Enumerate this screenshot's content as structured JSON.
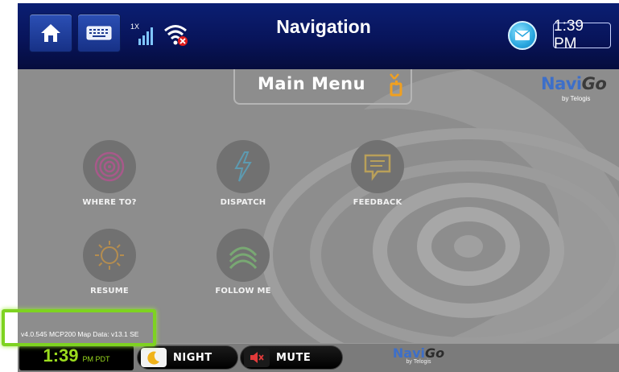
{
  "topbar": {
    "title": "Navigation",
    "time": "1:39 PM",
    "signal_label": "1X",
    "icons": [
      "home-icon",
      "keyboard-icon",
      "signal-icon",
      "wifi-off-icon",
      "mail-icon"
    ]
  },
  "main": {
    "title": "Main Menu",
    "brand": {
      "navi": "Navi",
      "go": "Go",
      "sub": "by Telogis"
    },
    "tiles": [
      {
        "label": "WHERE TO?",
        "icon": "target-icon"
      },
      {
        "label": "DISPATCH",
        "icon": "lightning-icon"
      },
      {
        "label": "FEEDBACK",
        "icon": "chat-icon"
      },
      {
        "label": "RESUME",
        "icon": "sun-icon"
      },
      {
        "label": "FOLLOW ME",
        "icon": "signal-waves-icon"
      }
    ],
    "version": "v4.0.545 MCP200   Map Data: v13.1 SE"
  },
  "bottombar": {
    "time": "1:39",
    "zone": "PM PDT",
    "night_label": "NIGHT",
    "mute_label": "MUTE",
    "brand": {
      "navi": "Navi",
      "go": "Go",
      "sub": "by Telogis"
    }
  },
  "colors": {
    "topbar": "#08145a",
    "accent_green": "#9bdc1e",
    "highlight": "#7ed321",
    "brand_blue": "#3d6fc9",
    "gps_orange": "#f0a020"
  }
}
